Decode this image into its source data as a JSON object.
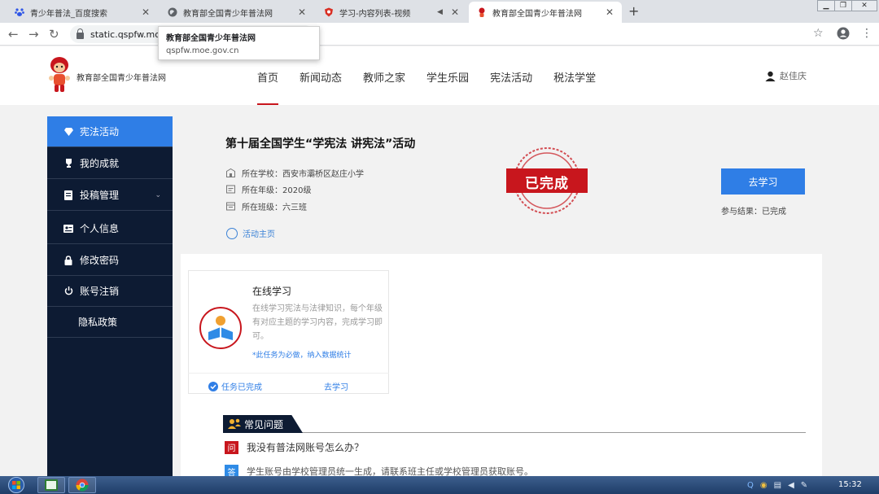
{
  "browser": {
    "tabs": [
      {
        "title": "青少年普法_百度搜索",
        "favicon": "baidu-paw-icon"
      },
      {
        "title": "教育部全国青少年普法网",
        "favicon": "globe-icon"
      },
      {
        "title": "学习-内容列表-视频",
        "favicon": "shield-icon"
      },
      {
        "title": "教育部全国青少年普法网",
        "favicon": "mascot-icon",
        "active": true
      }
    ],
    "url": "static.qspfw.mo",
    "tooltip": {
      "title": "教育部全国青少年普法网",
      "url": "qspfw.moe.gov.cn"
    }
  },
  "site": {
    "name": "教育部全国青少年普法网",
    "nav": [
      "首页",
      "新闻动态",
      "教师之家",
      "学生乐园",
      "宪法活动",
      "税法学堂"
    ],
    "active_nav": 0,
    "user": "赵佳庆"
  },
  "sidebar": {
    "items": [
      {
        "label": "宪法活动",
        "icon": "gem-icon",
        "active": true
      },
      {
        "label": "我的成就",
        "icon": "trophy-icon"
      },
      {
        "label": "投稿管理",
        "icon": "document-icon",
        "chevron": true
      },
      {
        "label": "个人信息",
        "icon": "id-card-icon"
      },
      {
        "label": "修改密码",
        "icon": "lock-icon"
      },
      {
        "label": "账号注销",
        "icon": "power-icon"
      },
      {
        "label": "隐私政策",
        "icon": ""
      }
    ]
  },
  "activity": {
    "title": "第十届全国学生“学宪法 讲宪法”活动",
    "school": "所在学校：西安市灞桥区赵庄小学",
    "grade": "所在年级：2020级",
    "class": "所在班级：六三班",
    "home_link": "活动主页",
    "stamp": "已完成",
    "study_button": "去学习",
    "result": "参与结果：已完成"
  },
  "task": {
    "title": "在线学习",
    "description": "在线学习宪法与法律知识，每个年级有对应主题的学习内容，完成学习即可。",
    "note": "*此任务为必做，纳入数据统计",
    "status": "任务已完成",
    "action": "去学习"
  },
  "faq": {
    "heading": "常见问题",
    "q_badge": "问",
    "question": "我没有普法网账号怎么办？",
    "a_badge": "答",
    "answer": "学生账号由学校管理员统一生成，请联系班主任或学校管理员获取账号。"
  },
  "taskbar": {
    "time": "15:32"
  },
  "colors": {
    "primary_blue": "#2f7ee6",
    "sidebar_navy": "#0d1b33",
    "stamp_red": "#c8161d"
  }
}
